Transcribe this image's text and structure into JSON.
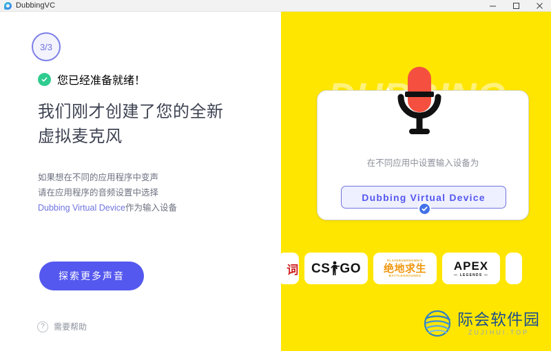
{
  "window": {
    "title": "DubbingVC",
    "app_icon": "dubbing-droplet-icon",
    "controls": {
      "minimize": "minimize-icon",
      "maximize": "maximize-icon",
      "close": "close-icon"
    }
  },
  "left": {
    "step_badge": "3/3",
    "ready_icon": "check-circle-icon",
    "ready_text": "您已经准备就绪！",
    "headline_line1": "我们刚才创建了您的全新",
    "headline_line2": "虚拟麦克风",
    "body_line1": "如果想在不同的应用程序中变声",
    "body_line2": "请在应用程序的音频设置中选择",
    "body_link": "Dubbing Virtual Device",
    "body_line3_suffix": "作为输入设备",
    "cta_label": "探索更多声音",
    "help_icon": "question-mark-icon",
    "help_label": "需要帮助"
  },
  "right": {
    "background_wordmark": "DUBBING",
    "mic_icon": "microphone-icon",
    "card": {
      "caption": "在不同应用中设置输入设备为",
      "device_name": "Dubbing  Virtual  Device",
      "selected_icon": "check-circle-icon"
    },
    "logos": [
      {
        "name": "logo-cn-partial",
        "text": "词.",
        "type": "cn"
      },
      {
        "name": "logo-csgo",
        "text": "CS GO",
        "type": "csgo"
      },
      {
        "name": "logo-pubg",
        "top": "PLAYERUNKNOWN'S",
        "main": "绝地求生",
        "bottom": "BATTLEGROUNDS",
        "type": "pubg"
      },
      {
        "name": "logo-apex",
        "main": "APEX",
        "sub": "— LEGENDS —",
        "type": "apex"
      },
      {
        "name": "logo-partial-right",
        "text": "",
        "type": "blank"
      }
    ]
  },
  "watermark": {
    "icon": "globe-icon",
    "cn": "际会软件园",
    "en": "ZUJIHUI.TOP"
  },
  "colors": {
    "accent_purple": "#5458ef",
    "yellow": "#ffe600",
    "green": "#2ecc8f",
    "mic_red": "#f5503f"
  }
}
